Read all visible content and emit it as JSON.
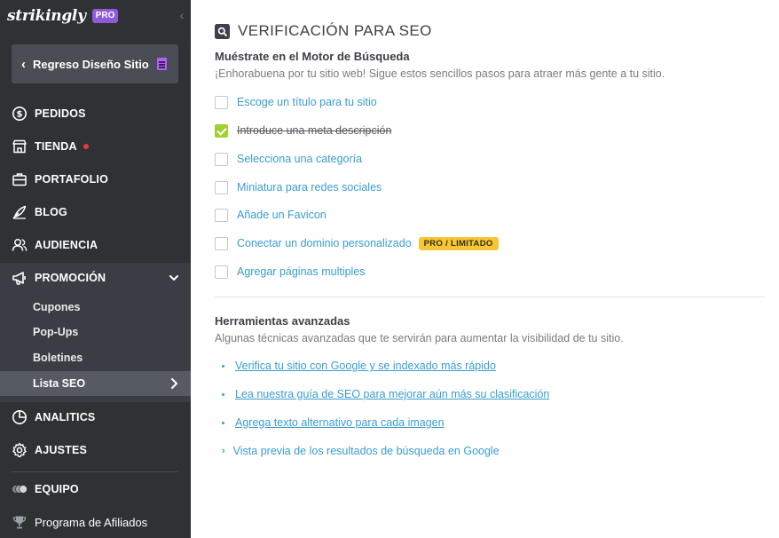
{
  "sidebar": {
    "brand": "strikingly",
    "pro_badge": "PRO",
    "back_button": "Regreso Diseño Sitio",
    "items": [
      {
        "label": "PEDIDOS"
      },
      {
        "label": "TIENDA"
      },
      {
        "label": "PORTAFOLIO"
      },
      {
        "label": "BLOG"
      },
      {
        "label": "AUDIENCIA"
      }
    ],
    "promotion": {
      "label": "PROMOCIÓN",
      "subitems": [
        {
          "label": "Cupones"
        },
        {
          "label": "Pop-Ups"
        },
        {
          "label": "Boletines"
        },
        {
          "label": "Lista SEO"
        }
      ]
    },
    "bottom_items": [
      {
        "label": "ANALITICS"
      },
      {
        "label": "AJUSTES"
      },
      {
        "label": "EQUIPO"
      },
      {
        "label": "Programa de Afiliados"
      }
    ]
  },
  "main": {
    "title": "VERIFICACIÓN PARA SEO",
    "search_section": {
      "title": "Muéstrate en el Motor de Búsqueda",
      "description": "¡Enhorabuena por tu sitio web! Sigue estos sencillos pasos para atraer más gente a tu sitio.",
      "tasks": [
        {
          "label": "Escoge un título para tu sitio",
          "checked": false
        },
        {
          "label": "Introduce una meta descripción",
          "checked": true
        },
        {
          "label": "Selecciona una categoría",
          "checked": false
        },
        {
          "label": "Miniatura para redes sociales",
          "checked": false
        },
        {
          "label": "Añade un Favicon",
          "checked": false
        },
        {
          "label": "Conectar un dominio personalizado",
          "checked": false,
          "badge": "PRO / LIMITADO"
        },
        {
          "label": "Agregar páginas multiples",
          "checked": false
        }
      ]
    },
    "advanced": {
      "title": "Herramientas avanzadas",
      "description": "Algunas técnicas avanzadas que te servirán para aumentar la visibilidad de tu sitio.",
      "links": [
        {
          "label": "Verifica tu sitio con Google y se indexado más rápido"
        },
        {
          "label": "Lea nuestra guía de SEO para mejorar aún más su clasificación"
        },
        {
          "label": "Agrega texto alternativo para cada imagen"
        },
        {
          "label": "Vista previa de los resultados de búsqueda en Google"
        }
      ]
    }
  },
  "colors": {
    "sidebar_bg": "#2f3134",
    "accent_link": "#3a9dd0",
    "check_green": "#9fd134",
    "pro_purple": "#8e5ad8",
    "badge_yellow": "#f4c638"
  }
}
